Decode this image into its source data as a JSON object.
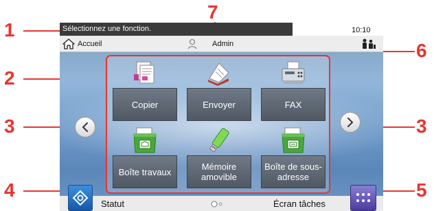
{
  "status_bar": {
    "message": "Sélectionnez une fonction.",
    "time": "10:10"
  },
  "nav": {
    "home_label": "Accueil",
    "user_label": "Admin"
  },
  "functions": [
    {
      "label": "Copier",
      "icon": "copier-icon"
    },
    {
      "label": "Envoyer",
      "icon": "send-icon"
    },
    {
      "label": "FAX",
      "icon": "fax-icon"
    },
    {
      "label": "Boîte travaux",
      "icon": "job-box-icon"
    },
    {
      "label": "Mémoire amovible",
      "icon": "usb-memory-icon"
    },
    {
      "label": "Boîte de sous-adresse",
      "icon": "subaddress-box-icon"
    }
  ],
  "bottom": {
    "status_label": "Statut",
    "tasks_label": "Écran tâches"
  },
  "callouts": [
    "1",
    "2",
    "3",
    "3",
    "4",
    "5",
    "6",
    "7"
  ],
  "colors": {
    "callout_red": "#e8352e",
    "tile_gray": "#5c6570",
    "status_blue": "#2a74c8",
    "tasks_purple": "#5a4aa8"
  }
}
